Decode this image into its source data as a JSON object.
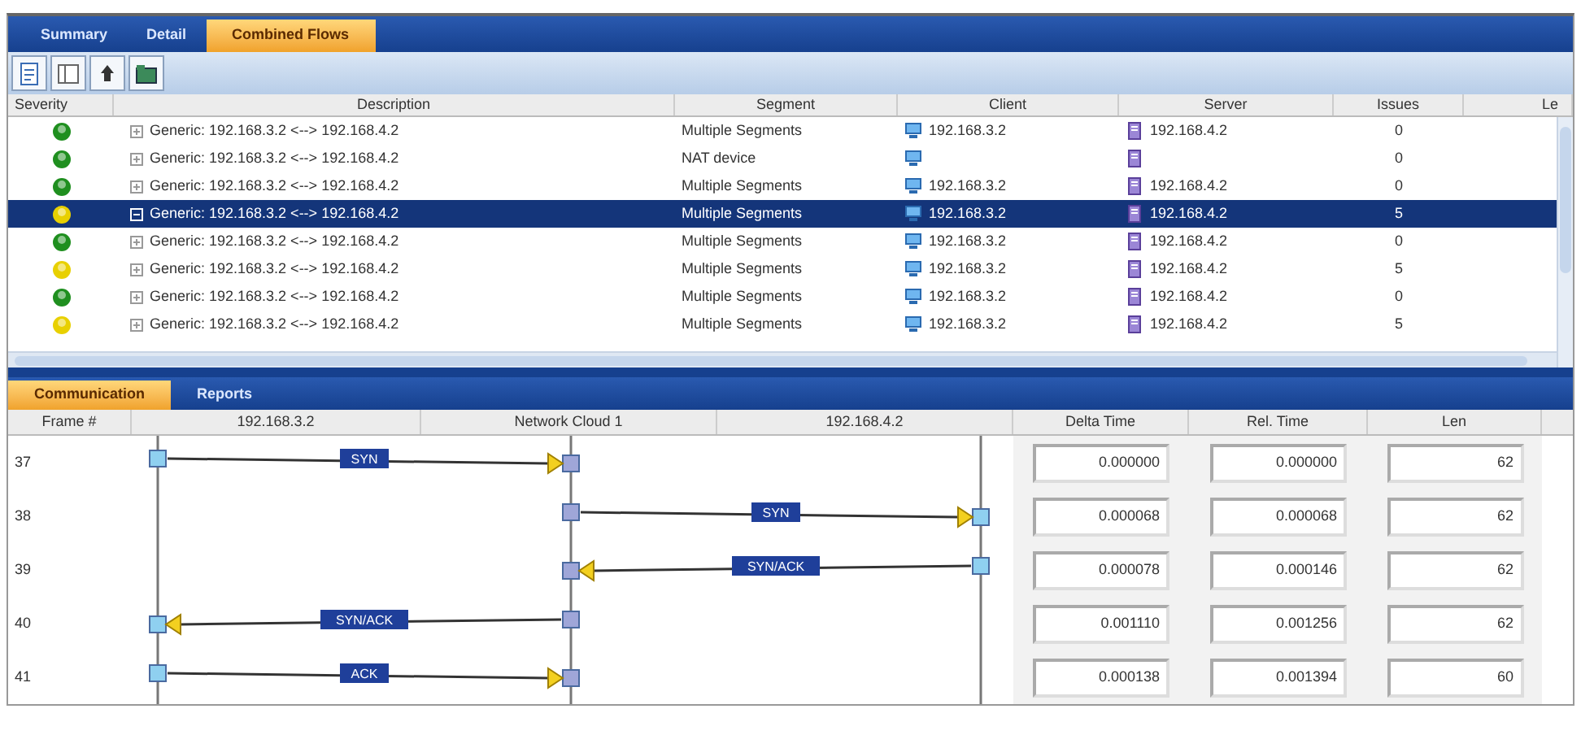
{
  "top_tabs": [
    {
      "label": "Summary",
      "selected": false
    },
    {
      "label": "Detail",
      "selected": false
    },
    {
      "label": "Combined Flows",
      "selected": true
    }
  ],
  "flows_table": {
    "columns": [
      "Severity",
      "Description",
      "Segment",
      "Client",
      "Server",
      "Issues",
      "Le"
    ],
    "rows": [
      {
        "color": "#1f8f1f",
        "description": "Generic: 192.168.3.2 <--> 192.168.4.2",
        "segment": "Multiple Segments",
        "client": "192.168.3.2",
        "server": "192.168.4.2",
        "issues": "0",
        "selected": false
      },
      {
        "color": "#1f8f1f",
        "description": "Generic: 192.168.3.2 <--> 192.168.4.2",
        "segment": "NAT device",
        "issues": "0",
        "selected": false
      },
      {
        "color": "#1f8f1f",
        "description": "Generic: 192.168.3.2 <--> 192.168.4.2",
        "segment": "Multiple Segments",
        "client": "192.168.3.2",
        "server": "192.168.4.2",
        "issues": "0",
        "selected": false
      },
      {
        "color": "#e8d000",
        "description": "Generic: 192.168.3.2 <--> 192.168.4.2",
        "segment": "Multiple Segments",
        "client": "192.168.3.2",
        "server": "192.168.4.2",
        "issues": "5",
        "selected": true
      },
      {
        "color": "#1f8f1f",
        "description": "Generic: 192.168.3.2 <--> 192.168.4.2",
        "segment": "Multiple Segments",
        "client": "192.168.3.2",
        "server": "192.168.4.2",
        "issues": "0",
        "selected": false
      },
      {
        "color": "#e8d000",
        "description": "Generic: 192.168.3.2 <--> 192.168.4.2",
        "segment": "Multiple Segments",
        "client": "192.168.3.2",
        "server": "192.168.4.2",
        "issues": "5",
        "selected": false
      },
      {
        "color": "#1f8f1f",
        "description": "Generic: 192.168.3.2 <--> 192.168.4.2",
        "segment": "Multiple Segments",
        "client": "192.168.3.2",
        "server": "192.168.4.2",
        "issues": "0",
        "selected": false
      },
      {
        "color": "#e8d000",
        "description": "Generic: 192.168.3.2 <--> 192.168.4.2",
        "segment": "Multiple Segments",
        "client": "192.168.3.2",
        "server": "192.168.4.2",
        "issues": "5",
        "selected": false
      }
    ]
  },
  "bottom_tabs": [
    {
      "label": "Communication",
      "selected": true
    },
    {
      "label": "Reports",
      "selected": false
    }
  ],
  "ladder": {
    "columns": [
      "Frame #",
      "192.168.3.2",
      "Network Cloud 1",
      "192.168.4.2",
      "Delta Time",
      "Rel. Time",
      "Len"
    ],
    "messages": [
      {
        "frame": "37",
        "label": "SYN",
        "kind": "client-to-cloud",
        "delta": "0.000000",
        "rel": "0.000000",
        "len": "62"
      },
      {
        "frame": "38",
        "label": "SYN",
        "kind": "cloud-to-server",
        "delta": "0.000068",
        "rel": "0.000068",
        "len": "62"
      },
      {
        "frame": "39",
        "label": "SYN/ACK",
        "kind": "server-to-cloud",
        "delta": "0.000078",
        "rel": "0.000146",
        "len": "62"
      },
      {
        "frame": "40",
        "label": "SYN/ACK",
        "kind": "cloud-to-client",
        "delta": "0.001110",
        "rel": "0.001256",
        "len": "62"
      },
      {
        "frame": "41",
        "label": "ACK",
        "kind": "client-to-cloud",
        "delta": "0.000138",
        "rel": "0.001394",
        "len": "60"
      }
    ]
  }
}
